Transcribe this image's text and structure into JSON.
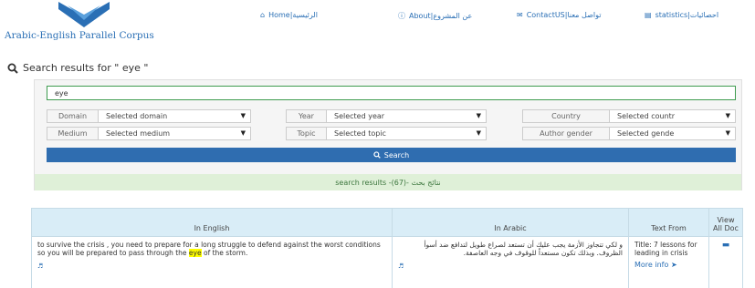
{
  "header": {
    "logo_text": "Arabic-English Parallel Corpus",
    "nav": [
      {
        "label": "Home|الرئيسية",
        "icon": "home-icon"
      },
      {
        "label": "About|عن المشروع",
        "icon": "info-icon"
      },
      {
        "label": "ContactUS|تواصل معنا",
        "icon": "envelope-icon"
      },
      {
        "label": "statistics|احصائيات",
        "icon": "bar-chart-icon"
      }
    ]
  },
  "search": {
    "heading": "Search results for \" eye \"",
    "query_value": "eye",
    "filters": {
      "domain": {
        "label": "Domain",
        "selected": "Selected domain"
      },
      "year": {
        "label": "Year",
        "selected": "Selected year"
      },
      "country": {
        "label": "Country",
        "selected": "Selected countr"
      },
      "medium": {
        "label": "Medium",
        "selected": "Selected medium"
      },
      "topic": {
        "label": "Topic",
        "selected": "Selected topic"
      },
      "author_gender": {
        "label": "Author gender",
        "selected": "Selected gende"
      }
    },
    "button_label": "Search",
    "results_count_text": "search results -(67)- نتائج بحث"
  },
  "results_table": {
    "headers": {
      "english": "In English",
      "arabic": "In Arabic",
      "from": "Text From",
      "view_all": "View All Doc"
    },
    "rows": [
      {
        "english_before": "to survive the crisis , you need to prepare for a long struggle to defend against the worst conditions so you will be prepared to pass through the ",
        "english_highlight": "eye",
        "english_after": " of the storm.",
        "arabic": "و لكي تتجاوز الأزمة يجب عليك أن تستعد لصراع طويل لتدافع ضد أسوأ الظروف. وبذلك تكون مستعداً للوقوف في وجه العاصفة.",
        "text_from": "Title: 7 lessons for leading in crisis",
        "more_info": "More info"
      }
    ]
  },
  "colors": {
    "brand_blue": "#2a6fb5",
    "button_blue": "#2f6db0",
    "input_border_green": "#3e9b4f",
    "results_bar_bg": "#dff0d8",
    "table_header_bg": "#d9edf7",
    "highlight": "#ffff00"
  }
}
